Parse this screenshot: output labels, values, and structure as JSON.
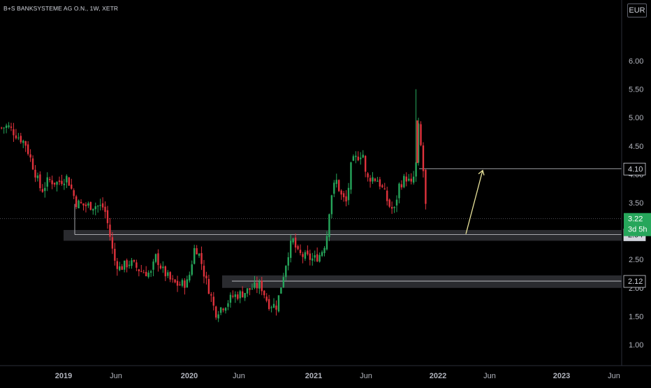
{
  "header": {
    "symbol_text": "B+S BANKSYSTEME AG O.N., 1W, XETR",
    "currency": "EUR"
  },
  "price_scale": {
    "ticks": [
      "6.00",
      "5.50",
      "5.00",
      "4.50",
      "4.00",
      "3.50",
      "3.00",
      "2.50",
      "2.00",
      "1.50",
      "1.00"
    ],
    "last_price": "3.22",
    "countdown": "3d 5h",
    "level_labels": [
      "4.10",
      "2.94",
      "2.12"
    ]
  },
  "time_axis": {
    "labels": [
      "2019",
      "Jun",
      "2020",
      "Jun",
      "2021",
      "Jun",
      "2022",
      "Jun",
      "2023",
      "Jun"
    ]
  },
  "colors": {
    "background": "#000000",
    "up": "#26a65b",
    "down": "#e0323c",
    "zone": "#2a2b2f",
    "arrow": "#e8e29a",
    "level_line": "#cfd1d6",
    "last_price_badge": "#26a65b"
  },
  "chart_data": {
    "type": "candlestick",
    "interval": "1W",
    "currency": "EUR",
    "ylim": [
      0.6,
      6.1
    ],
    "zones": [
      {
        "from": 2.83,
        "to": 3.02
      },
      {
        "from": 2.0,
        "to": 2.22
      }
    ],
    "horizontal_levels": [
      4.1,
      2.94,
      2.12
    ],
    "last_price": 3.22,
    "arrow": {
      "from_price": 2.95,
      "to_price": 4.07,
      "from_date": "2022-05",
      "to_date": "2022-05"
    },
    "series": [
      {
        "date": "2018-12",
        "close": 4.9
      },
      {
        "date": "2019-02",
        "close": 3.9
      },
      {
        "date": "2019-04",
        "close": 3.5
      },
      {
        "date": "2019-06",
        "close": 2.4
      },
      {
        "date": "2019-08",
        "close": 2.3
      },
      {
        "date": "2019-10",
        "close": 2.3
      },
      {
        "date": "2019-12",
        "close": 2.1
      },
      {
        "date": "2020-02",
        "close": 2.7
      },
      {
        "date": "2020-03",
        "close": 1.4
      },
      {
        "date": "2020-05",
        "close": 1.9
      },
      {
        "date": "2020-07",
        "close": 2.0
      },
      {
        "date": "2020-09",
        "close": 1.7
      },
      {
        "date": "2020-10",
        "close": 2.9
      },
      {
        "date": "2020-12",
        "close": 2.5
      },
      {
        "date": "2021-01",
        "close": 3.8
      },
      {
        "date": "2021-03",
        "close": 4.0
      },
      {
        "date": "2021-05",
        "close": 4.3
      },
      {
        "date": "2021-07",
        "close": 3.8
      },
      {
        "date": "2021-09",
        "close": 3.4
      },
      {
        "date": "2021-10",
        "close": 4.0
      },
      {
        "date": "2021-11",
        "close": 4.2
      },
      {
        "date": "2021-12",
        "close": 3.22
      }
    ]
  }
}
